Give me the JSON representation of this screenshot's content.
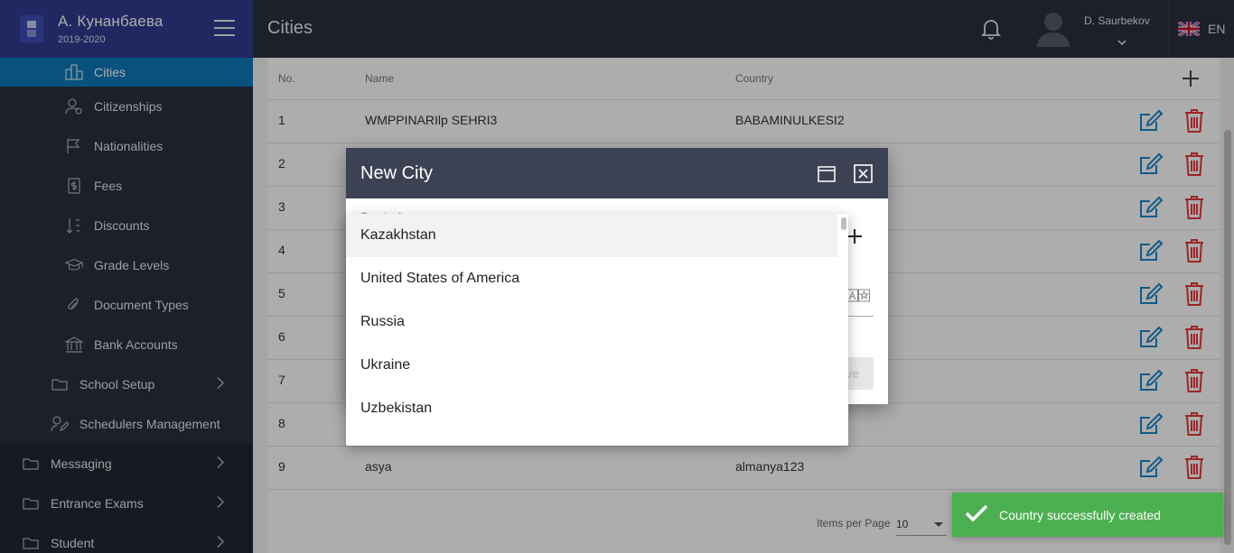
{
  "brand": {
    "name": "А. Кунанбаева",
    "year": "2019-2020"
  },
  "header": {
    "title": "Cities",
    "user": "D. Saurbekov",
    "language": "EN"
  },
  "sidebar": {
    "items": [
      {
        "label": "Cities",
        "icon": "city-icon",
        "active": true
      },
      {
        "label": "Citizenships",
        "icon": "citizenship-icon"
      },
      {
        "label": "Nationalities",
        "icon": "flag-icon"
      },
      {
        "label": "Fees",
        "icon": "fee-icon"
      },
      {
        "label": "Discounts",
        "icon": "discount-icon"
      },
      {
        "label": "Grade Levels",
        "icon": "graduation-cap-icon"
      },
      {
        "label": "Document Types",
        "icon": "paperclip-icon"
      },
      {
        "label": "Bank Accounts",
        "icon": "bank-icon"
      }
    ],
    "groups": [
      {
        "label": "School Setup",
        "icon": "folder-icon"
      },
      {
        "label": "Schedulers Management",
        "icon": "user-edit-icon"
      }
    ],
    "top": [
      {
        "label": "Messaging",
        "icon": "folder-icon"
      },
      {
        "label": "Entrance Exams",
        "icon": "folder-icon"
      },
      {
        "label": "Student",
        "icon": "folder-icon"
      }
    ]
  },
  "table": {
    "columns": {
      "no": "No.",
      "name": "Name",
      "country": "Country"
    },
    "rows": [
      {
        "no": "1",
        "name": "WMPPINARIlp SEHRI3",
        "country": "BABAMINULKESI2"
      },
      {
        "no": "2",
        "name": "",
        "country": ""
      },
      {
        "no": "3",
        "name": "",
        "country": ""
      },
      {
        "no": "4",
        "name": "",
        "country": ""
      },
      {
        "no": "5",
        "name": "",
        "country": ""
      },
      {
        "no": "6",
        "name": "",
        "country": ""
      },
      {
        "no": "7",
        "name": "",
        "country": ""
      },
      {
        "no": "8",
        "name": "",
        "country": ""
      },
      {
        "no": "9",
        "name": "asya",
        "country": "almanya123"
      }
    ]
  },
  "pager": {
    "label": "Items per Page",
    "value": "10"
  },
  "dialog": {
    "title": "New City",
    "country_label": "Country",
    "required_mark": "*",
    "save_label": "ve"
  },
  "dropdown": {
    "options": [
      "Kazakhstan",
      "United States of America",
      "Russia",
      "Ukraine",
      "Uzbekistan"
    ]
  },
  "toast": {
    "message": "Country successfully created"
  },
  "colors": {
    "accent": "#0d7ab8",
    "danger": "#e53935",
    "success": "#4caf50",
    "header": "#2b2f3e"
  }
}
